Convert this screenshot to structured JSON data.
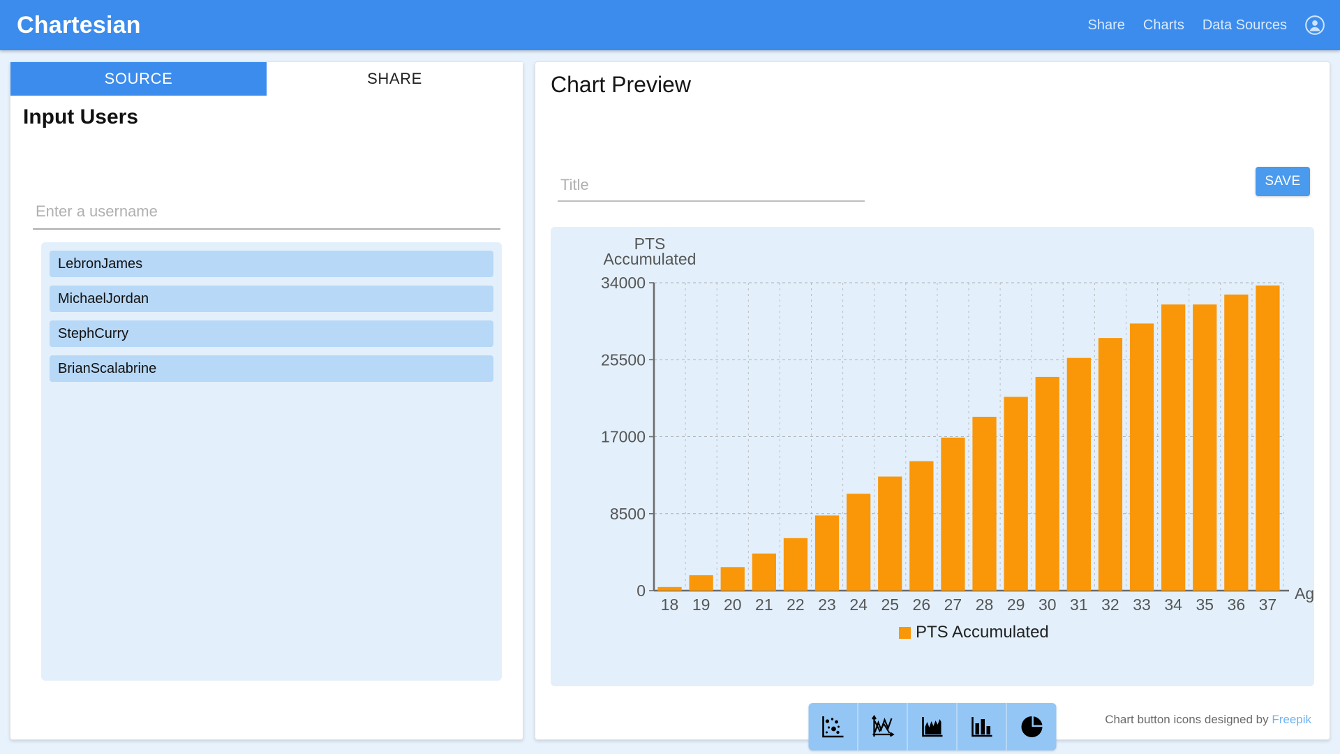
{
  "app": {
    "brand": "Chartesian",
    "accent_color": "#3b8ced",
    "page_background": "#e8f2fc"
  },
  "navbar": {
    "links": [
      {
        "label": "Share"
      },
      {
        "label": "Charts"
      },
      {
        "label": "Data Sources"
      }
    ],
    "account_icon": "user-account-icon"
  },
  "left_panel": {
    "tabs": [
      {
        "label": "SOURCE",
        "active": true
      },
      {
        "label": "SHARE",
        "active": false
      }
    ],
    "heading": "Input Users",
    "username_input": {
      "value": "",
      "placeholder": "Enter a username"
    },
    "users": [
      {
        "name": "LebronJames"
      },
      {
        "name": "MichaelJordan"
      },
      {
        "name": "StephCurry"
      },
      {
        "name": "BrianScalabrine"
      }
    ]
  },
  "right_panel": {
    "heading": "Chart Preview",
    "title_input": {
      "value": "",
      "placeholder": "Title"
    },
    "save_label": "SAVE",
    "chart_type_buttons": [
      {
        "name": "scatter-chart-button",
        "icon": "scatter-plot-icon"
      },
      {
        "name": "line-chart-button",
        "icon": "line-chart-icon"
      },
      {
        "name": "area-chart-button",
        "icon": "area-chart-icon"
      },
      {
        "name": "bar-chart-button",
        "icon": "bar-chart-icon"
      },
      {
        "name": "pie-chart-button",
        "icon": "pie-chart-icon"
      }
    ],
    "credit_text": "Chart button icons designed by ",
    "credit_link": "Freepik"
  },
  "chart_data": {
    "type": "bar",
    "title": "",
    "xlabel": "Age",
    "ylabel": "PTS Accumulated",
    "categories": [
      18,
      19,
      20,
      21,
      22,
      23,
      24,
      25,
      26,
      27,
      28,
      29,
      30,
      31,
      32,
      33,
      34,
      35,
      36,
      37
    ],
    "series": [
      {
        "name": "PTS Accumulated",
        "color": "#f99709",
        "values": [
          400,
          1700,
          2600,
          4100,
          5800,
          8300,
          10700,
          12600,
          14300,
          16900,
          19200,
          21400,
          23600,
          25700,
          27900,
          29500,
          31600,
          31600,
          32700,
          33700
        ]
      }
    ],
    "ylim": [
      0,
      34000
    ],
    "yticks": [
      0,
      8500,
      17000,
      25500,
      34000
    ],
    "xticks": [
      18,
      19,
      20,
      21,
      22,
      23,
      24,
      25,
      26,
      27,
      28,
      29,
      30,
      31,
      32,
      33,
      34,
      35,
      36,
      37
    ],
    "grid": true,
    "legend": {
      "position": "bottom",
      "entries": [
        "PTS Accumulated"
      ]
    },
    "plot_background": "#e3f0fb",
    "axis_color": "#6b6b6b"
  }
}
